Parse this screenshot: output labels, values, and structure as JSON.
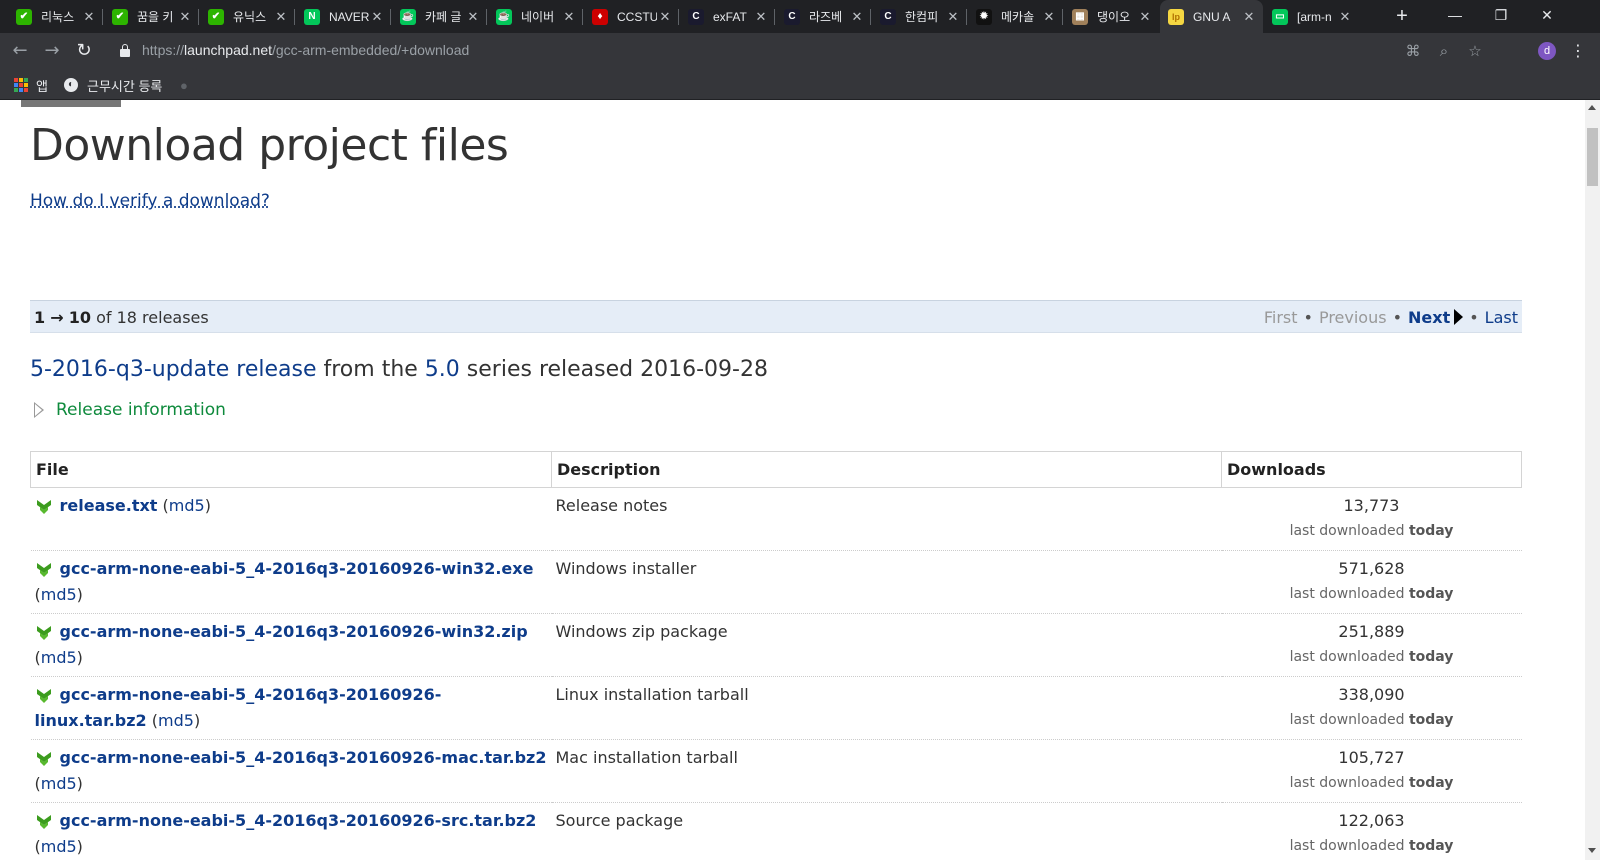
{
  "browser": {
    "tabs": [
      {
        "title": "리눅스",
        "favicon_color": "#2db400",
        "favicon_glyph": "✔"
      },
      {
        "title": "꿈을 키",
        "favicon_color": "#2db400",
        "favicon_glyph": "✔"
      },
      {
        "title": "유닉스",
        "favicon_color": "#2db400",
        "favicon_glyph": "✔"
      },
      {
        "title": "NAVER",
        "favicon_color": "#03c75a",
        "favicon_glyph": "N"
      },
      {
        "title": "카페 글",
        "favicon_color": "#03c75a",
        "favicon_glyph": "☕"
      },
      {
        "title": "네이버",
        "favicon_color": "#03c75a",
        "favicon_glyph": "☕"
      },
      {
        "title": "CCSTU",
        "favicon_color": "#cc0000",
        "favicon_glyph": "♦"
      },
      {
        "title": "exFAT",
        "favicon_color": "#1a1a2e",
        "favicon_glyph": "C"
      },
      {
        "title": "라즈베",
        "favicon_color": "#1a1a2e",
        "favicon_glyph": "C"
      },
      {
        "title": "한컴피",
        "favicon_color": "#1a1a2e",
        "favicon_glyph": "C"
      },
      {
        "title": "메카솔",
        "favicon_color": "#111111",
        "favicon_glyph": "✹"
      },
      {
        "title": "댕이오",
        "favicon_color": "#a0805a",
        "favicon_glyph": "▦"
      },
      {
        "title": "GNU A",
        "favicon_color": "#f5d742",
        "favicon_glyph": "lp"
      },
      {
        "title": "[arm-n",
        "favicon_color": "#03c75a",
        "favicon_glyph": "▭"
      }
    ],
    "active_tab_index": 12,
    "new_tab_label": "+",
    "window_controls": {
      "minimize": "—",
      "maximize": "❐",
      "close": "✕"
    },
    "address": {
      "host": "launchpad.net",
      "scheme": "https://",
      "path": "/gcc-arm-embedded/+download"
    },
    "profile_initial": "d",
    "bookmarks": [
      {
        "label": "앱",
        "icon": "apps-grid-icon"
      },
      {
        "label": "근무시간 등록",
        "icon": "globe-icon"
      },
      {
        "label": "",
        "icon": "apple-icon"
      }
    ]
  },
  "page": {
    "title": "Download project files",
    "verify_link": "How do I verify a download?",
    "batch": {
      "start": "1",
      "arrow": "→",
      "end": "10",
      "of_text": "of 18 releases",
      "first": "First",
      "previous": "Previous",
      "next": "Next",
      "last": "Last"
    },
    "release": {
      "name": "5-2016-q3-update release",
      "from_text": "from the",
      "series": "5.0",
      "series_text": "series released 2016-09-28",
      "info_label": "Release information"
    },
    "table": {
      "headers": {
        "file": "File",
        "description": "Description",
        "downloads": "Downloads"
      },
      "last_downloaded_text": "last downloaded",
      "md5_label": "md5",
      "rows": [
        {
          "file": "release.txt",
          "description": "Release notes",
          "downloads": "13,773",
          "last": "today"
        },
        {
          "file": "gcc-arm-none-eabi-5_4-2016q3-20160926-win32.exe",
          "description": "Windows installer",
          "downloads": "571,628",
          "last": "today"
        },
        {
          "file": "gcc-arm-none-eabi-5_4-2016q3-20160926-win32.zip",
          "description": "Windows zip package",
          "downloads": "251,889",
          "last": "today"
        },
        {
          "file": "gcc-arm-none-eabi-5_4-2016q3-20160926-linux.tar.bz2",
          "description": "Linux installation tarball",
          "downloads": "338,090",
          "last": "today"
        },
        {
          "file": "gcc-arm-none-eabi-5_4-2016q3-20160926-mac.tar.bz2",
          "description": "Mac installation tarball",
          "downloads": "105,727",
          "last": "today"
        },
        {
          "file": "gcc-arm-none-eabi-5_4-2016q3-20160926-src.tar.bz2",
          "description": "Source package",
          "downloads": "122,063",
          "last": "today"
        }
      ]
    }
  }
}
